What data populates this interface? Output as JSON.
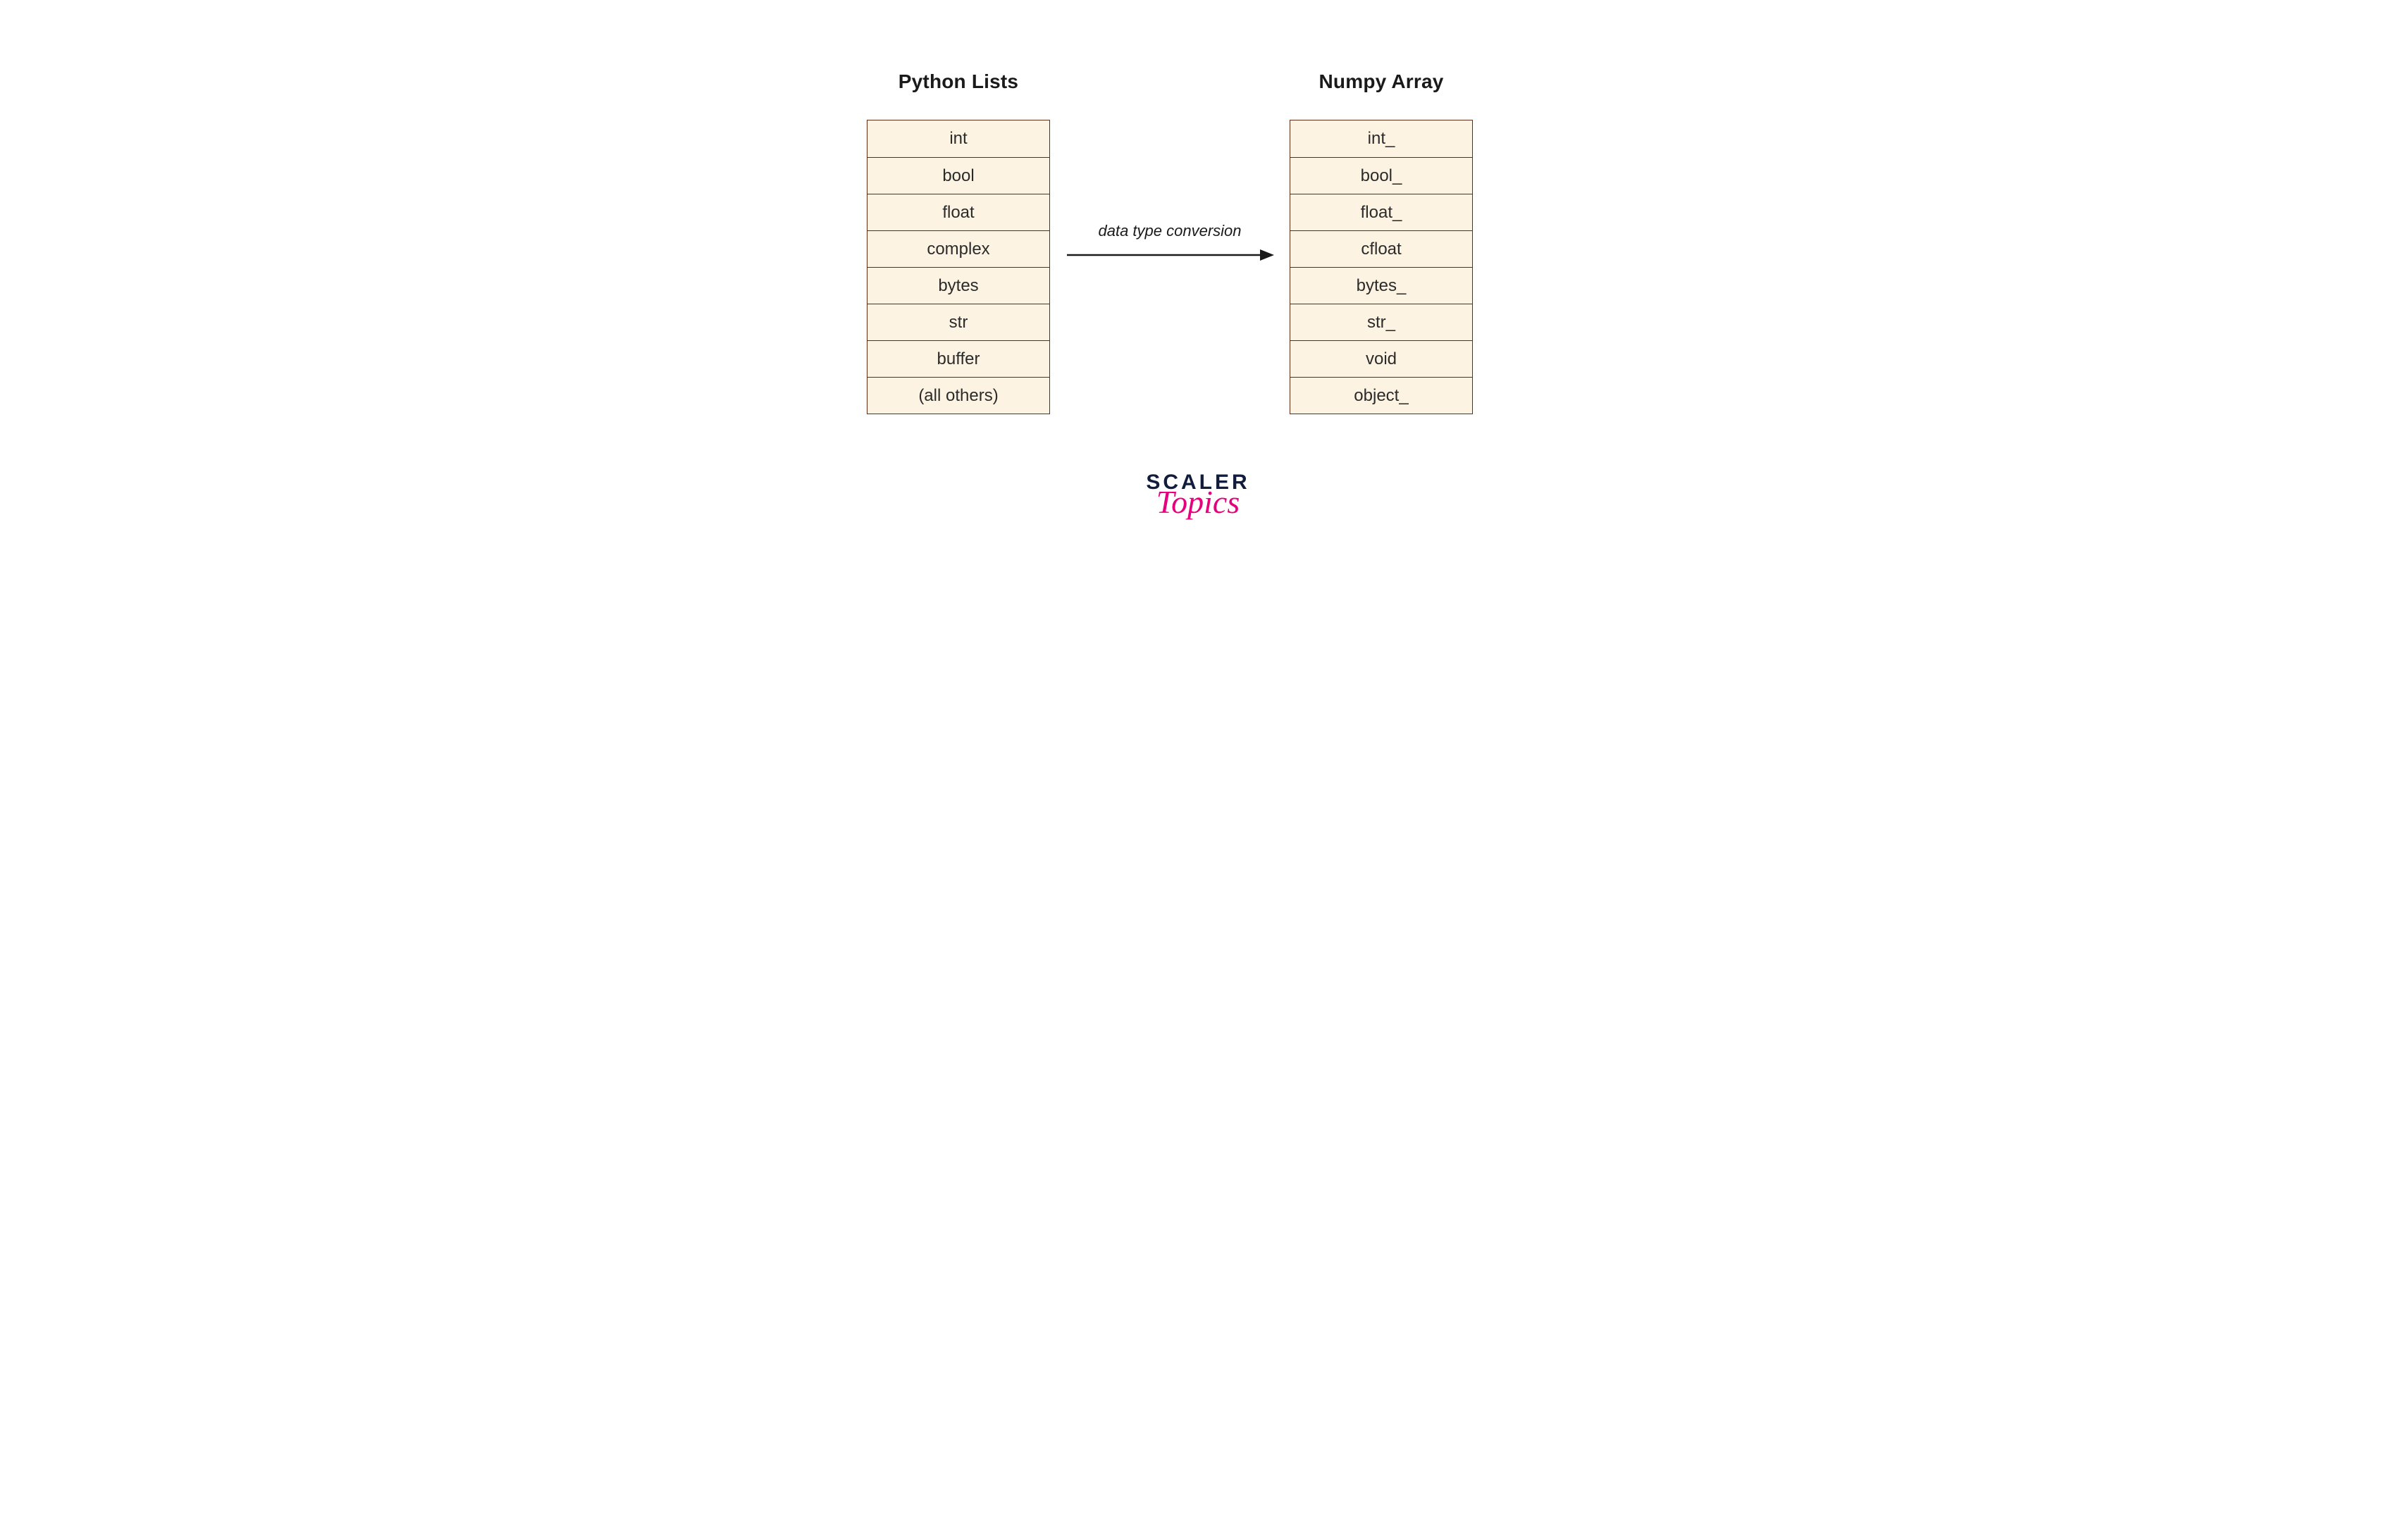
{
  "headings": {
    "left": "Python Lists",
    "right": "Numpy Array"
  },
  "arrow_label": "data type conversion",
  "python_types": [
    "int",
    "bool",
    "float",
    "complex",
    "bytes",
    "str",
    "buffer",
    "(all others)"
  ],
  "numpy_types": [
    "int_",
    "bool_",
    "float_",
    "cfloat",
    "bytes_",
    "str_",
    "void",
    "object_"
  ],
  "logo": {
    "line1": "SCALER",
    "line2": "Topics"
  },
  "colors": {
    "cell_bg": "#fdf3e2",
    "cell_border": "#5e2d14",
    "logo_primary": "#121c3b",
    "logo_accent": "#e6007e"
  }
}
